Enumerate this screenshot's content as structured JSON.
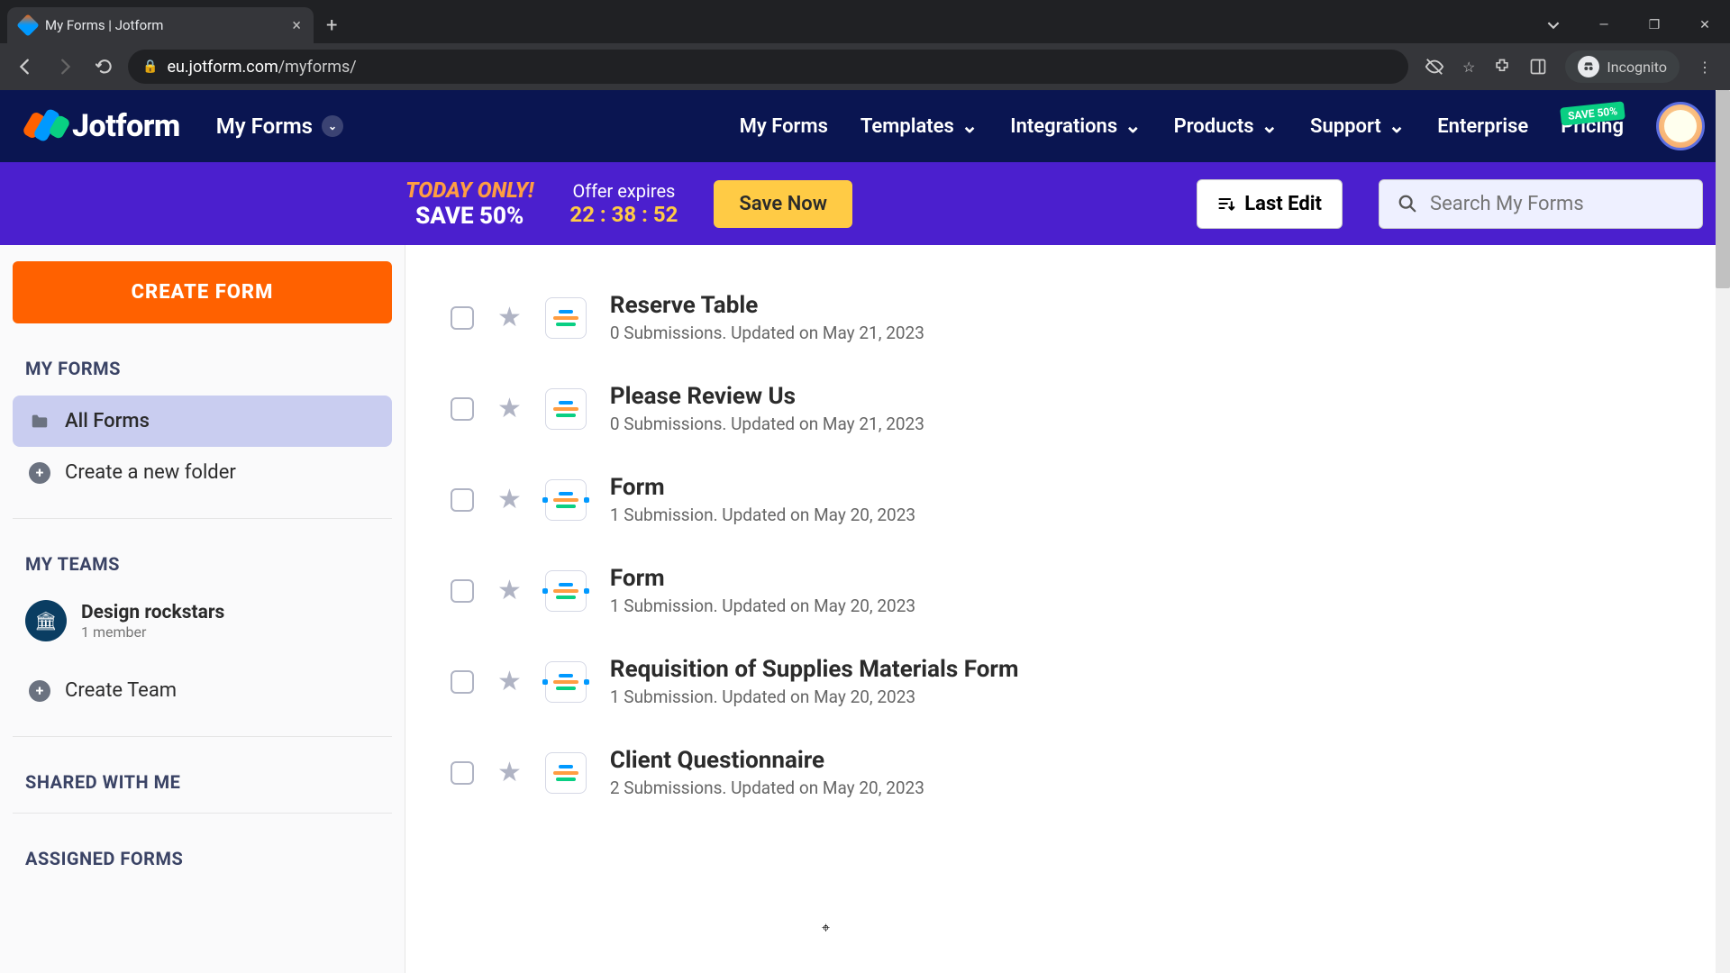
{
  "browser": {
    "tab_title": "My Forms | Jotform",
    "url_host": "eu.jotform.com",
    "url_path": "/myforms/",
    "incognito_label": "Incognito"
  },
  "header": {
    "logo_text": "Jotform",
    "dropdown_label": "My Forms",
    "nav": {
      "my_forms": "My Forms",
      "templates": "Templates",
      "integrations": "Integrations",
      "products": "Products",
      "support": "Support",
      "enterprise": "Enterprise",
      "pricing": "Pricing"
    },
    "save_badge": "SAVE 50%"
  },
  "promo": {
    "line1": "TODAY ONLY!",
    "line2": "SAVE 50%",
    "expires_label": "Offer expires",
    "timer": "22 : 38 : 52",
    "save_now": "Save Now",
    "last_edit": "Last Edit",
    "search_placeholder": "Search My Forms"
  },
  "sidebar": {
    "create_btn": "CREATE FORM",
    "sections": {
      "my_forms": "MY FORMS",
      "my_teams": "MY TEAMS",
      "shared": "SHARED WITH ME",
      "assigned": "ASSIGNED FORMS"
    },
    "all_forms": "All Forms",
    "create_folder": "Create a new folder",
    "team": {
      "name": "Design rockstars",
      "sub": "1 member"
    },
    "create_team": "Create Team"
  },
  "forms": [
    {
      "title": "Reserve Table",
      "sub": "0 Submissions. Updated on May 21, 2023",
      "icon": "classic"
    },
    {
      "title": "Please Review Us",
      "sub": "0 Submissions. Updated on May 21, 2023",
      "icon": "classic"
    },
    {
      "title": "Form",
      "sub": "1 Submission. Updated on May 20, 2023",
      "icon": "card"
    },
    {
      "title": "Form",
      "sub": "1 Submission. Updated on May 20, 2023",
      "icon": "card"
    },
    {
      "title": "Requisition of Supplies Materials Form",
      "sub": "1 Submission. Updated on May 20, 2023",
      "icon": "card"
    },
    {
      "title": "Client Questionnaire",
      "sub": "2 Submissions. Updated on May 20, 2023",
      "icon": "classic"
    }
  ]
}
